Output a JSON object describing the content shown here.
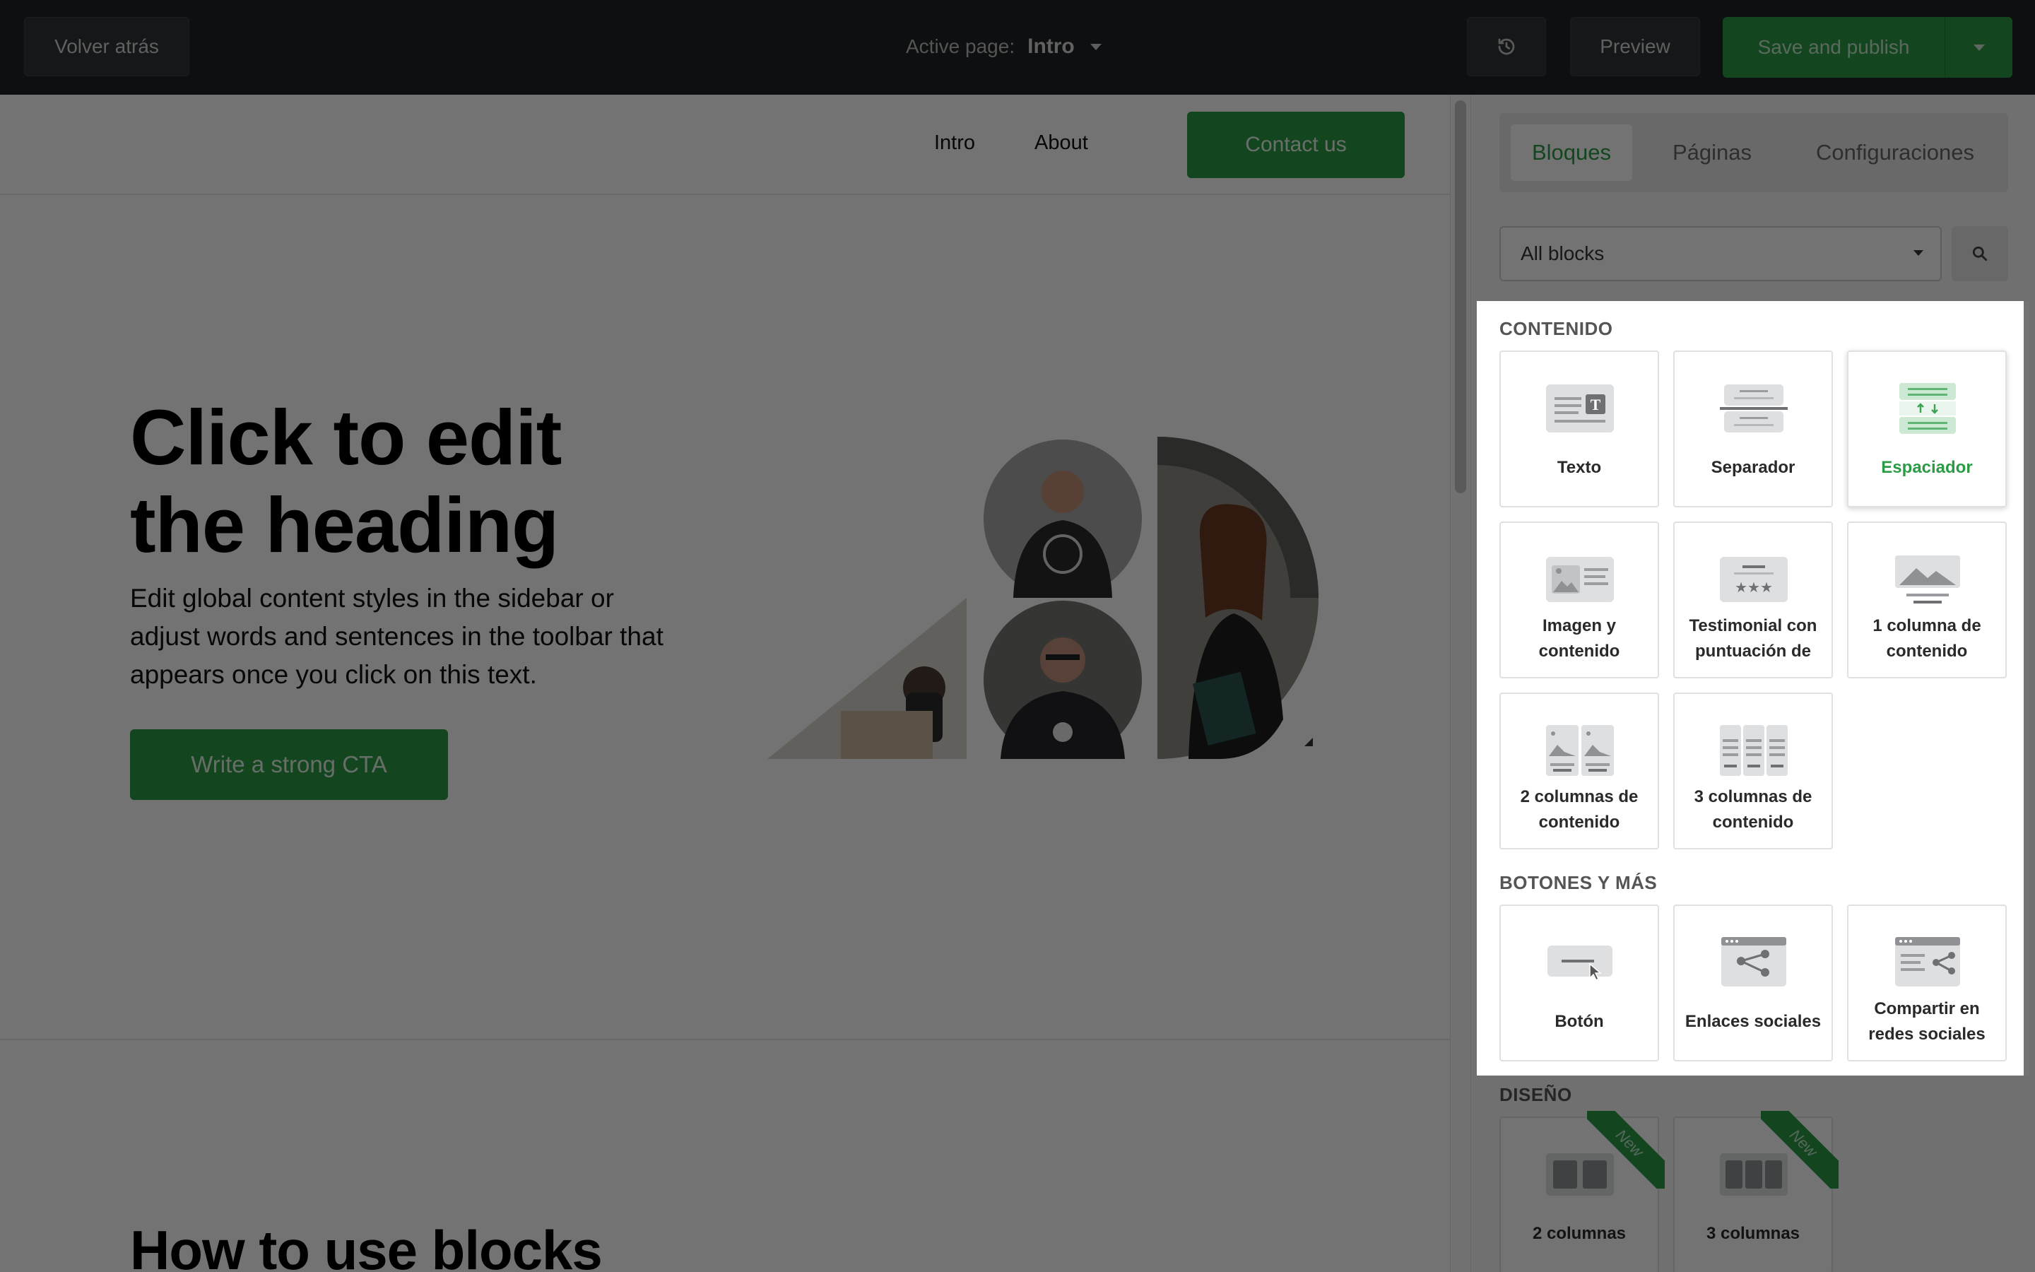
{
  "topbar": {
    "back_label": "Volver atrás",
    "active_page_label": "Active page:",
    "active_page_value": "Intro",
    "history_icon": "history-icon",
    "preview_label": "Preview",
    "publish_label": "Save and publish"
  },
  "site": {
    "nav": {
      "intro": "Intro",
      "about": "About",
      "contact": "Contact us"
    },
    "hero": {
      "heading_line1": "Click to edit",
      "heading_line2": "the heading",
      "body": "Edit global content styles in the sidebar or adjust words and sentences in the toolbar that appears once you click on this text.",
      "cta": "Write a strong CTA"
    },
    "section2_heading": "How to use blocks"
  },
  "sidebar": {
    "tabs": [
      "Bloques",
      "Páginas",
      "Configuraciones"
    ],
    "active_tab": "Bloques",
    "filter_value": "All blocks",
    "search_icon": "search-icon",
    "sections": {
      "contenido": {
        "label": "CONTENIDO",
        "blocks": [
          "Texto",
          "Separador",
          "Espaciador",
          "Imagen y contenido",
          "Testimonial con puntuación de",
          "1 columna de contenido",
          "2 columnas de contenido",
          "3 columnas de contenido"
        ]
      },
      "botones": {
        "label": "BOTONES Y MÁS",
        "blocks": [
          "Botón",
          "Enlaces sociales",
          "Compartir en redes sociales"
        ]
      },
      "diseno": {
        "label": "DISEÑO",
        "blocks": [
          "2 columnas",
          "3 columnas"
        ],
        "badge": "New"
      }
    },
    "selected_block": "Espaciador"
  },
  "colors": {
    "brand_green": "#2c9b46",
    "topbar": "#1f2225",
    "overlay": "rgba(0,0,0,0.55)"
  }
}
